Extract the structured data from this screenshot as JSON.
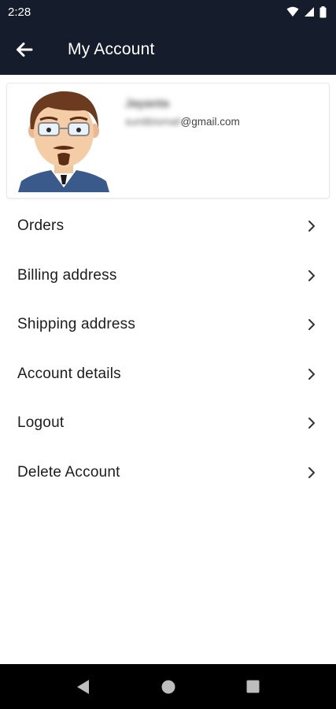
{
  "status_bar": {
    "time": "2:28",
    "icons": [
      "wifi-icon",
      "signal-icon",
      "battery-icon"
    ]
  },
  "app_bar": {
    "title": "My Account",
    "back_icon": "arrow-left-icon"
  },
  "profile": {
    "name": "Jayanta",
    "email_user": "sunitbismail",
    "email_domain": "@gmail.com"
  },
  "menu": {
    "items": [
      {
        "label": "Orders"
      },
      {
        "label": "Billing address"
      },
      {
        "label": "Shipping address"
      },
      {
        "label": "Account details"
      },
      {
        "label": "Logout"
      },
      {
        "label": "Delete Account"
      }
    ],
    "chevron_icon": "chevron-right-icon"
  },
  "nav_bar": {
    "buttons": [
      "back-triangle-icon",
      "home-circle-icon",
      "recents-square-icon"
    ]
  },
  "colors": {
    "header_bg": "#151c2b",
    "nav_bg": "#000000",
    "text_primary": "#1c1c1c"
  }
}
